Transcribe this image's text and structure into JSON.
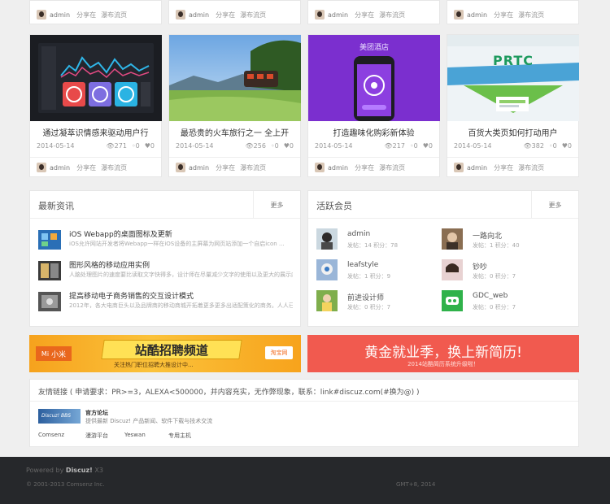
{
  "top_cards": [
    {
      "user": "admin",
      "share": "分享在",
      "gallery": "瀑布流页"
    },
    {
      "user": "admin",
      "share": "分享在",
      "gallery": "瀑布流页"
    },
    {
      "user": "admin",
      "share": "分享在",
      "gallery": "瀑布流页"
    },
    {
      "user": "admin",
      "share": "分享在",
      "gallery": "瀑布流页"
    }
  ],
  "cards": [
    {
      "title": "通过凝萃识情感来驱动用户行",
      "date": "2014-05-14",
      "views": "271",
      "comments": "0",
      "likes": "0",
      "user": "admin",
      "share": "分享在",
      "gallery": "瀑布流页"
    },
    {
      "title": "最恐贵的火车旅行之一 全上开",
      "date": "2014-05-14",
      "views": "256",
      "comments": "0",
      "likes": "0",
      "user": "admin",
      "share": "分享在",
      "gallery": "瀑布流页"
    },
    {
      "title": "打造趣味化购彩新体验",
      "date": "2014-05-14",
      "views": "217",
      "comments": "0",
      "likes": "0",
      "user": "admin",
      "share": "分享在",
      "gallery": "瀑布流页",
      "image_text": "美团酒店"
    },
    {
      "title": "百货大类页如何打动用户",
      "date": "2014-05-14",
      "views": "382",
      "comments": "0",
      "likes": "0",
      "user": "admin",
      "share": "分享在",
      "gallery": "瀑布流页",
      "image_text": "PRTC"
    }
  ],
  "news": {
    "title": "最新资讯",
    "more": "更多",
    "items": [
      {
        "title": "iOS Webapp的桌面图标及更新",
        "desc": "iOS允许网站开发者将Webapp一样在iOS设备的主屏幕为网页站添加一个自启icon ..."
      },
      {
        "title": "图形风格的移动应用实例",
        "desc": "人脑处理图片的速度要比读取文字快得多，设计师在尽量减少文字的使用以及更大的展示内容"
      },
      {
        "title": "提高移动电子商务销售的交互设计模式",
        "desc": "2012年，各大电商巨头以及品牌商的移动商城开拓着更多更多出适配策化的商务。人人已"
      }
    ]
  },
  "members": {
    "title": "活跃会员",
    "more": "更多",
    "items": [
      {
        "name": "admin",
        "stats": "发帖：14 积分：78"
      },
      {
        "name": "一路向北",
        "stats": "发帖：1 积分：40"
      },
      {
        "name": "leafstyle",
        "stats": "发帖：1 积分：9"
      },
      {
        "name": "钞吵",
        "stats": "发帖：0 积分：7"
      },
      {
        "name": "前进设计师",
        "stats": "发帖：0 积分：7"
      },
      {
        "name": "GDC_web",
        "stats": "发帖：0 积分：7"
      }
    ]
  },
  "banner_left": {
    "brand": "小米",
    "title": "站酷招聘频道",
    "sub": "关注热门职位招聘大推设计中...",
    "partner": "淘宝网"
  },
  "banner_right": {
    "title": "黄金就业季，换上新简历!",
    "sub": "2014站酷简历系统升级啦！"
  },
  "links": {
    "title": "友情链接 ( 申请要求：PR>=3，ALEXA<500000，并内容充实，无作弊现象，联系：link#discuz.com(#换为@) )",
    "official_name": "官方论坛",
    "official_desc": "提供最新 Discuz! 产品新闻、软件下载与技术交流",
    "logo_text": "Discuz! BBS",
    "items": [
      "Comsenz",
      "漫游平台",
      "Yeswan",
      "专用主机"
    ]
  },
  "footer": {
    "powered_prefix": "Powered by",
    "brand": "Discuz!",
    "version": "X3",
    "copyright": "© 2001-2013 Comsenz Inc.",
    "gmt": "GMT+8, 2014"
  },
  "colors": {
    "accent_purple": "#7b2fcf",
    "banner_orange": "#f7a31c",
    "banner_red": "#f15a4f",
    "footer_bg": "#26282b"
  }
}
